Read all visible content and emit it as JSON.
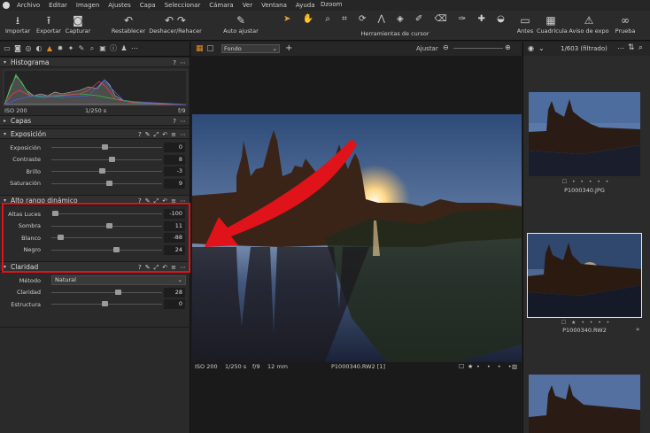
{
  "menubar": {
    "items": [
      "Archivo",
      "Editar",
      "Imagen",
      "Ajustes",
      "Capa",
      "Seleccionar",
      "Cámara",
      "Ver",
      "Ventana",
      "Ayuda"
    ],
    "title": "Dzoom"
  },
  "toolbar": {
    "importar": "Importar",
    "exportar": "Exportar",
    "capturar": "Capturar",
    "restablecer": "Restablecer",
    "deshacer": "Deshacer/Rehacer",
    "auto_ajustar": "Auto ajustar",
    "herramientas_cursor": "Herramientas de cursor",
    "antes": "Antes",
    "cuadricula": "Cuadrícula",
    "aviso_expo": "Aviso de expo",
    "prueba": "Prueba"
  },
  "histogram": {
    "title": "Histograma",
    "iso": "ISO 200",
    "shutter": "1/250 s",
    "aperture": "f/9"
  },
  "capas": {
    "title": "Capas"
  },
  "exposicion": {
    "title": "Exposición",
    "rows": [
      {
        "label": "Exposición",
        "value": "0"
      },
      {
        "label": "Contraste",
        "value": "8"
      },
      {
        "label": "Brillo",
        "value": "-3"
      },
      {
        "label": "Saturación",
        "value": "9"
      }
    ]
  },
  "hdr": {
    "title": "Alto rango dinámico",
    "rows": [
      {
        "label": "Altas Luces",
        "value": "-100"
      },
      {
        "label": "Sombra",
        "value": "11"
      },
      {
        "label": "Blanco",
        "value": "-88"
      },
      {
        "label": "Negro",
        "value": "24"
      }
    ]
  },
  "claridad": {
    "title": "Claridad",
    "metodo_label": "Método",
    "metodo_value": "Natural",
    "rows": [
      {
        "label": "Claridad",
        "value": "28"
      },
      {
        "label": "Estructura",
        "value": "0"
      }
    ]
  },
  "viewer": {
    "background_select": "Fondo",
    "fit_label": "Ajustar",
    "info_iso": "ISO 200",
    "info_shutter": "1/250 s",
    "info_aperture": "f/9",
    "info_focal": "12 mm",
    "info_filename": "P1000340.RW2 [1]"
  },
  "browser": {
    "count": "1/603 (filtrado)",
    "thumbs": [
      {
        "name": "P1000340.JPG"
      },
      {
        "name": "P1000340.RW2"
      }
    ]
  },
  "colors": {
    "accent_orange": "#e58a1f",
    "highlight_red": "#e0121a"
  }
}
